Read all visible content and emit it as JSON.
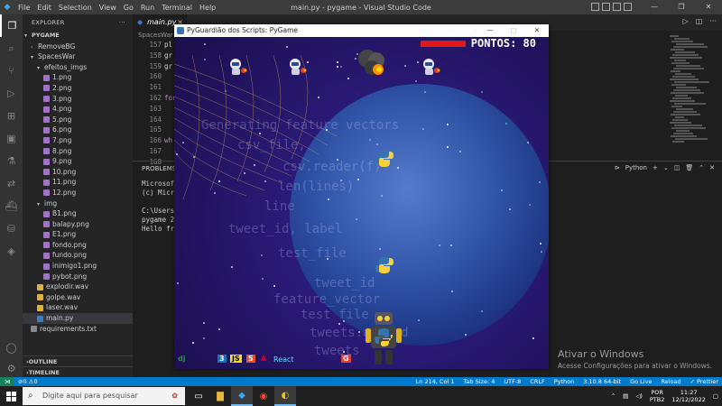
{
  "vscode": {
    "menu": [
      "File",
      "Edit",
      "Selection",
      "View",
      "Go",
      "Run",
      "Terminal",
      "Help"
    ],
    "window_title": "main.py - pygame - Visual Studio Code",
    "explorer_title": "EXPLORER",
    "root": "PYGAME",
    "tree": [
      {
        "label": "RemoveBG",
        "kind": "folder-closed",
        "depth": 1
      },
      {
        "label": "SpacesWar",
        "kind": "folder-open",
        "depth": 1
      },
      {
        "label": "efeitos_imgs",
        "kind": "folder-open",
        "depth": 2
      },
      {
        "label": "1.png",
        "kind": "png",
        "depth": 3
      },
      {
        "label": "2.png",
        "kind": "png",
        "depth": 3
      },
      {
        "label": "3.png",
        "kind": "png",
        "depth": 3
      },
      {
        "label": "4.png",
        "kind": "png",
        "depth": 3
      },
      {
        "label": "5.png",
        "kind": "png",
        "depth": 3
      },
      {
        "label": "6.png",
        "kind": "png",
        "depth": 3
      },
      {
        "label": "7.png",
        "kind": "png",
        "depth": 3
      },
      {
        "label": "8.png",
        "kind": "png",
        "depth": 3
      },
      {
        "label": "9.png",
        "kind": "png",
        "depth": 3
      },
      {
        "label": "10.png",
        "kind": "png",
        "depth": 3
      },
      {
        "label": "11.png",
        "kind": "png",
        "depth": 3
      },
      {
        "label": "12.png",
        "kind": "png",
        "depth": 3
      },
      {
        "label": "img",
        "kind": "folder-open",
        "depth": 2
      },
      {
        "label": "B1.png",
        "kind": "png",
        "depth": 3
      },
      {
        "label": "balapy.png",
        "kind": "png",
        "depth": 3
      },
      {
        "label": "E1.png",
        "kind": "png",
        "depth": 3
      },
      {
        "label": "fondo.png",
        "kind": "png",
        "depth": 3
      },
      {
        "label": "fundo.png",
        "kind": "png",
        "depth": 3
      },
      {
        "label": "inimigo1.png",
        "kind": "png",
        "depth": 3
      },
      {
        "label": "pybot.png",
        "kind": "png",
        "depth": 3
      },
      {
        "label": "explodir.wav",
        "kind": "wav",
        "depth": 2
      },
      {
        "label": "golpe.wav",
        "kind": "wav",
        "depth": 2
      },
      {
        "label": "laser.wav",
        "kind": "wav",
        "depth": 2
      },
      {
        "label": "main.py",
        "kind": "py",
        "depth": 2,
        "selected": true
      },
      {
        "label": "requirements.txt",
        "kind": "txt",
        "depth": 1
      }
    ],
    "outline": "OUTLINE",
    "timeline": "TIMELINE",
    "tab_label": "main.py",
    "breadcrumb": "SpacesWar",
    "line_numbers": [
      "157",
      "158",
      "159",
      "160",
      "161",
      "162",
      "163",
      "164",
      "165",
      "166",
      "167",
      "168"
    ],
    "code_lines": [
      "pl",
      "gr",
      "gr",
      "",
      "",
      "for",
      "",
      "",
      "",
      "wh",
      "",
      ""
    ],
    "panel_tab": "PROBLEMS",
    "terminal_shell": "Python",
    "terminal_lines": [
      "Microsoft",
      "(c) Micro",
      "",
      "C:\\Users\\",
      "pygame 2.",
      "Hello fro"
    ],
    "activate_title": "Ativar o Windows",
    "activate_sub": "Acesse Configurações para ativar o Windows.",
    "status_problems": "⊘0 ⚠0",
    "status_right": [
      "Ln 214, Col 1",
      "Tab Size: 4",
      "UTF-8",
      "CRLF",
      "Python",
      "3.10.8 64-bit",
      "Go Live",
      "Reload",
      "✓ Prettier"
    ]
  },
  "game": {
    "title": "PyGuardião dos Scripts: PyGame",
    "score_text": "PONTOS: 80",
    "life_fraction": 1.0,
    "bg_text": [
      "Generating feature vectors",
      "csv_file,",
      "csv.reader(f)",
      "len(lines)",
      "line",
      "tweet_id, label",
      "test_file",
      "tweet_id",
      "feature_vector",
      "test file",
      "tweets.append",
      "tweets"
    ],
    "logo_labels": [
      "dj",
      "3",
      "JS",
      "5",
      "A",
      "React",
      "G"
    ]
  },
  "taskbar": {
    "search_placeholder": "Digite aqui para pesquisar",
    "lang_top": "POR",
    "lang_bottom": "PTB2",
    "time": "11:27",
    "date": "12/12/2022"
  }
}
